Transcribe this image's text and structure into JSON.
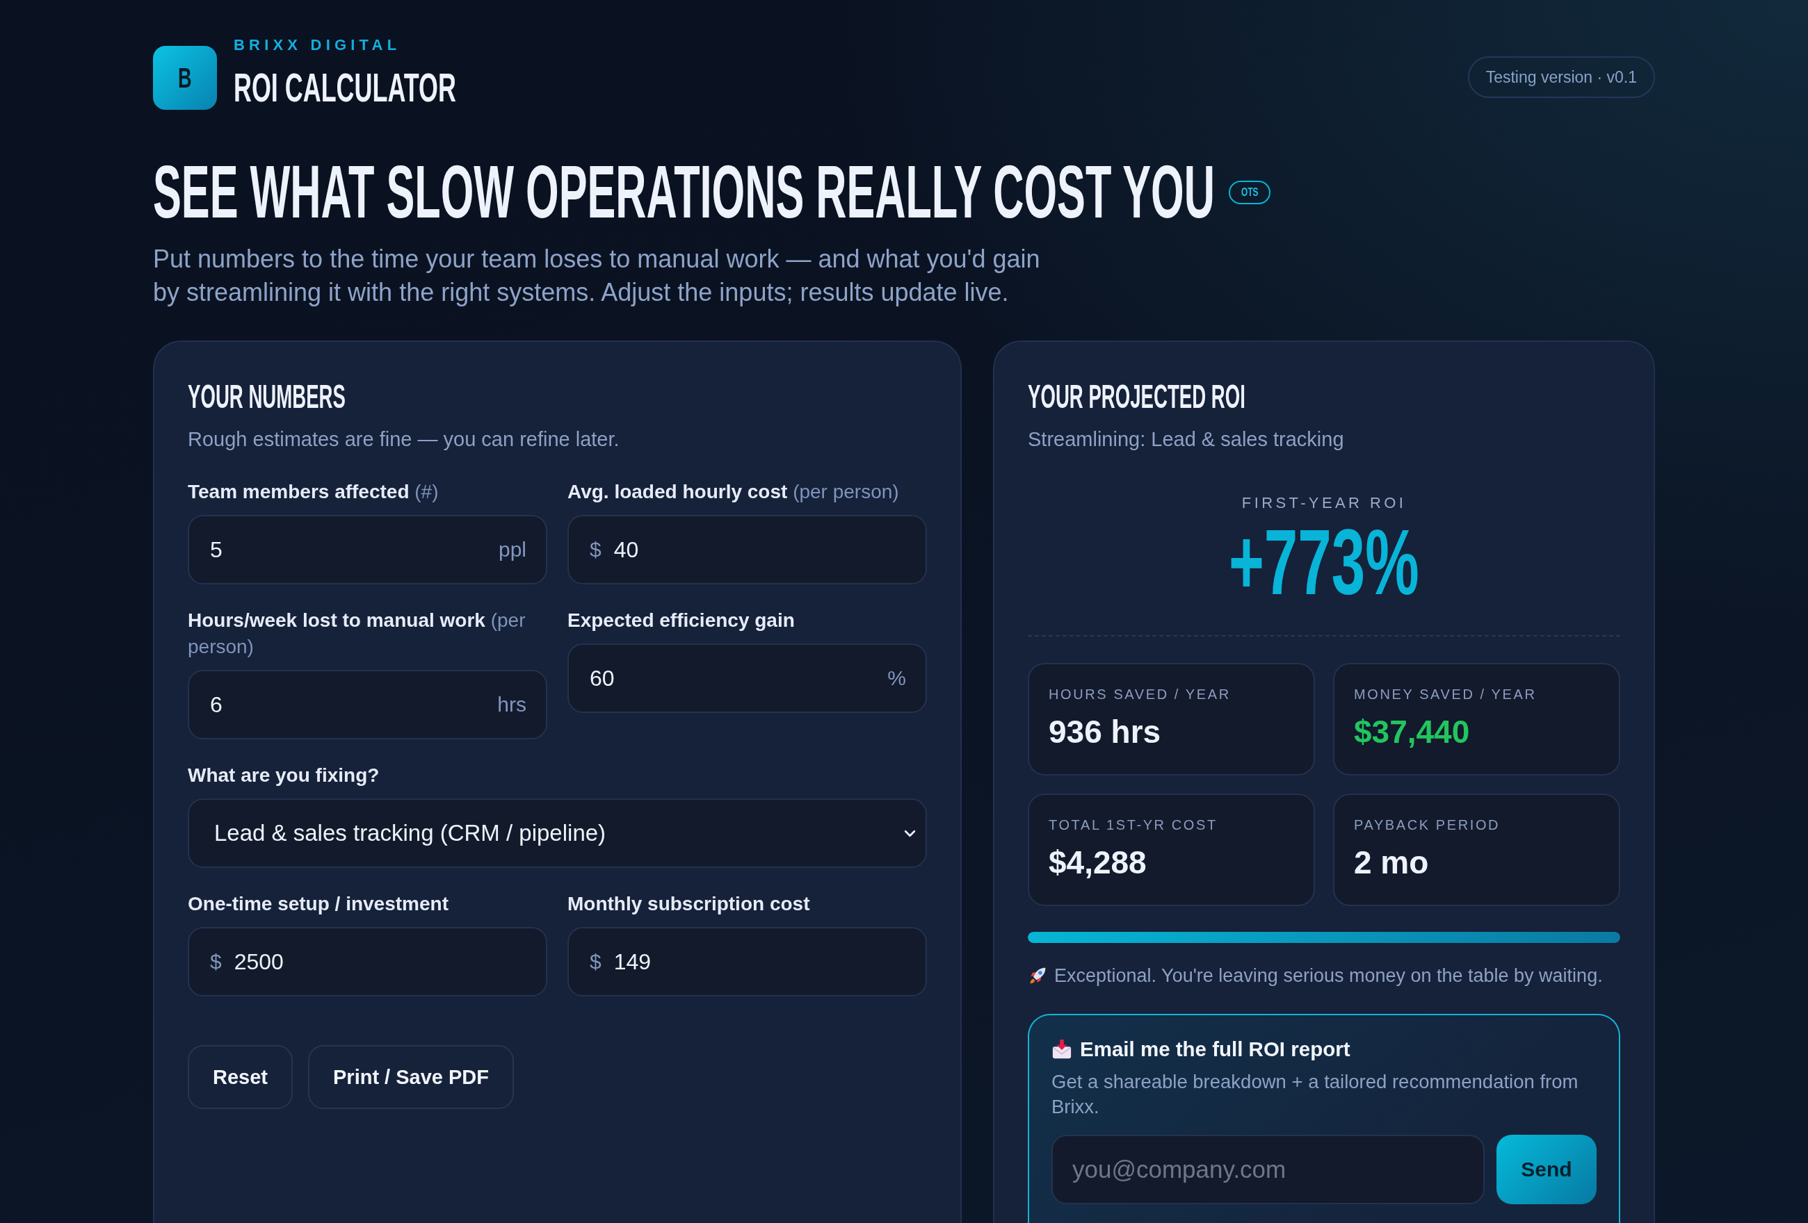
{
  "header": {
    "logo_letter": "B",
    "brand": "BRIXX DIGITAL",
    "title": "ROI CALCULATOR",
    "version_badge": "Testing version · v0.1"
  },
  "hero": {
    "headline": "SEE WHAT SLOW OPERATIONS REALLY COST YOU",
    "badge": "OTS",
    "intro": "Put numbers to the time your team loses to manual work — and what you'd gain by streamlining it with the right systems. Adjust the inputs; results update live."
  },
  "inputs_panel": {
    "title": "YOUR NUMBERS",
    "subtitle": "Rough estimates are fine — you can refine later.",
    "fields": [
      {
        "kind": "number",
        "label": "Team members affected",
        "hint": "(#)",
        "value": "5",
        "suffix": "ppl"
      },
      {
        "kind": "number",
        "label": "Avg. loaded hourly cost",
        "hint": "(per person)",
        "prefix": "$",
        "value": "40"
      },
      {
        "kind": "number",
        "label": "Hours/week lost to manual work",
        "hint": "(per person)",
        "value": "6",
        "suffix": "hrs"
      },
      {
        "kind": "number",
        "label": "Expected efficiency gain",
        "value": "60",
        "suffix": "%"
      },
      {
        "kind": "select",
        "label": "What are you fixing?",
        "value": "Lead & sales tracking (CRM / pipeline)"
      },
      {
        "kind": "number",
        "label": "One-time setup / investment",
        "prefix": "$",
        "value": "2500"
      },
      {
        "kind": "number",
        "label": "Monthly subscription cost",
        "prefix": "$",
        "value": "149"
      }
    ],
    "buttons": [
      "Reset",
      "Print / Save PDF"
    ]
  },
  "results_panel": {
    "title": "YOUR PROJECTED ROI",
    "subtitle": "Streamlining: Lead & sales tracking",
    "roi_label": "FIRST-YEAR ROI",
    "roi_value": "+773%",
    "stats": [
      {
        "label": "HOURS SAVED / YEAR",
        "value": "936 hrs",
        "color": "#eef2fa"
      },
      {
        "label": "MONEY SAVED / YEAR",
        "value": "$37,440",
        "color": "#22c55e"
      },
      {
        "label": "TOTAL 1ST-YR COST",
        "value": "$4,288",
        "color": "#eef2fa"
      },
      {
        "label": "PAYBACK PERIOD",
        "value": "2 mo",
        "color": "#eef2fa"
      }
    ],
    "progress": {
      "level": 1.0
    },
    "verdict": "Exceptional. You're leaving serious money on the table by waiting.",
    "email_card": {
      "title": "Email me the full ROI report",
      "description": "Get a shareable breakdown + a tailored recommendation from Brixx.",
      "placeholder": "you@company.com",
      "button": "Send"
    }
  }
}
